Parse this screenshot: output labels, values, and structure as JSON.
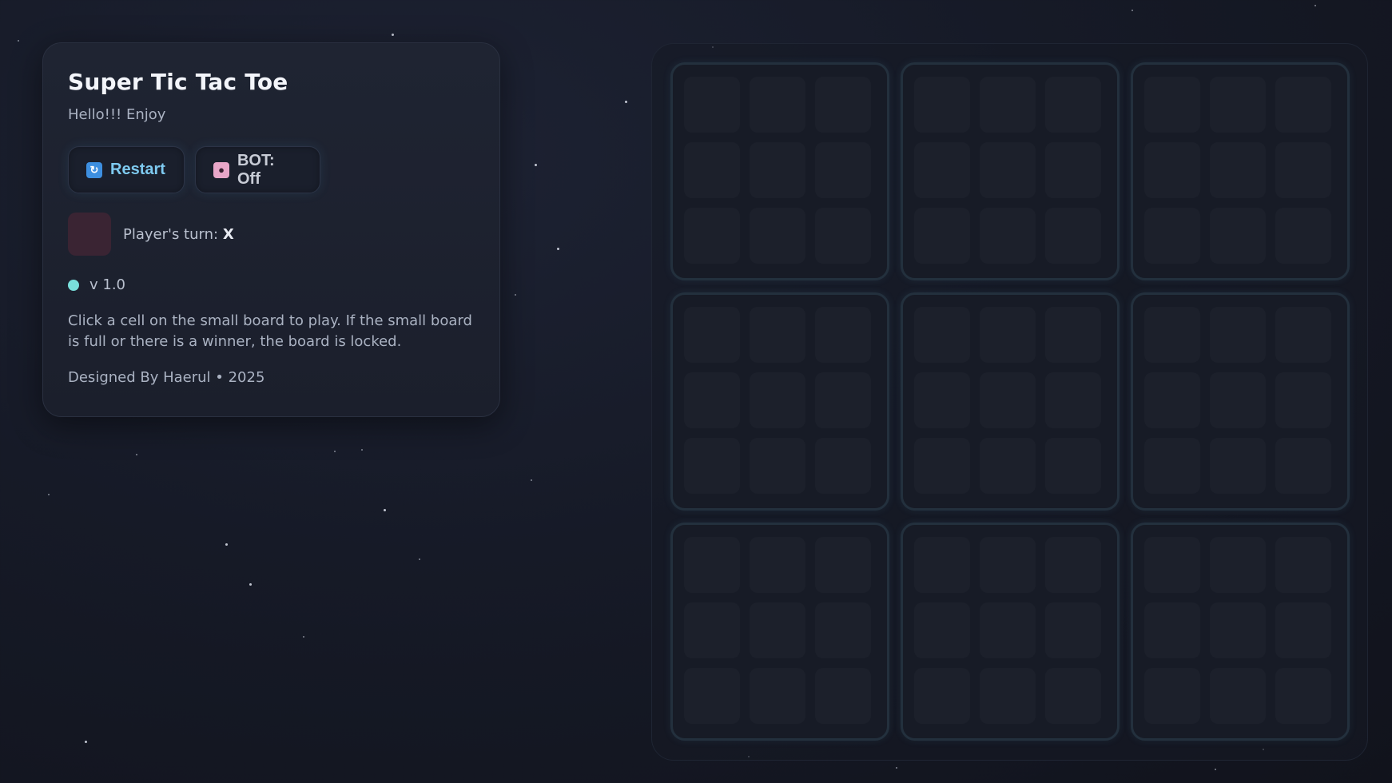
{
  "panel": {
    "title": "Super Tic Tac Toe",
    "subtitle": "Hello!!! Enjoy",
    "restart_label": "Restart",
    "bot_label": "BOT: Off",
    "turn_prefix": "Player's turn: ",
    "turn_player": "X",
    "version": "v 1.0",
    "help_text": "Click a cell on the small board to play. If the small board is full or there is a winner, the board is locked.",
    "credit": "Designed By Haerul • 2025"
  },
  "icons": {
    "restart": "restart-icon",
    "bot": "robot-icon"
  },
  "colors": {
    "accent_restart": "#7ecaf0",
    "status_dot": "#79e0dc",
    "turn_swatch": "#3a2433",
    "mini_border": "#23303d"
  },
  "board": {
    "mini_boards": [
      [
        "",
        "",
        "",
        "",
        "",
        "",
        "",
        "",
        ""
      ],
      [
        "",
        "",
        "",
        "",
        "",
        "",
        "",
        "",
        ""
      ],
      [
        "",
        "",
        "",
        "",
        "",
        "",
        "",
        "",
        ""
      ],
      [
        "",
        "",
        "",
        "",
        "",
        "",
        "",
        "",
        ""
      ],
      [
        "",
        "",
        "",
        "",
        "",
        "",
        "",
        "",
        ""
      ],
      [
        "",
        "",
        "",
        "",
        "",
        "",
        "",
        "",
        ""
      ],
      [
        "",
        "",
        "",
        "",
        "",
        "",
        "",
        "",
        ""
      ],
      [
        "",
        "",
        "",
        "",
        "",
        "",
        "",
        "",
        ""
      ],
      [
        "",
        "",
        "",
        "",
        "",
        "",
        "",
        "",
        ""
      ]
    ]
  }
}
